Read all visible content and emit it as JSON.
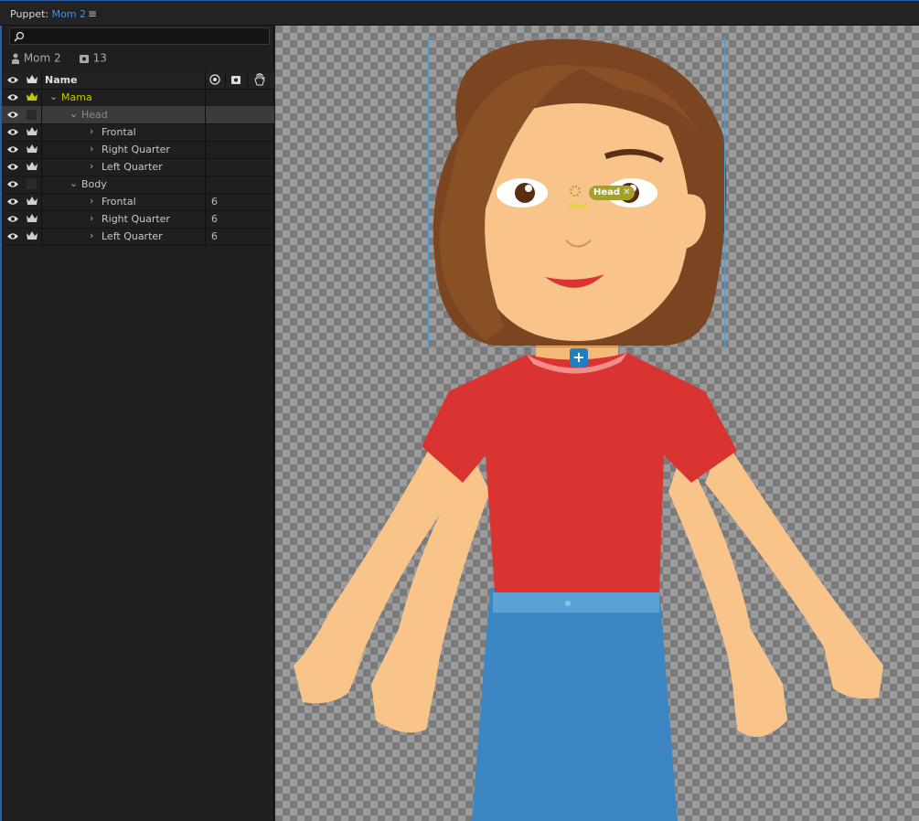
{
  "panel": {
    "title_prefix": "Puppet:",
    "title_name": "Mom 2",
    "menu_icon": "hamburger-icon"
  },
  "search": {
    "placeholder": ""
  },
  "puppet_info": {
    "name": "Mom 2",
    "count": "13"
  },
  "columns": {
    "name": "Name"
  },
  "rows": [
    {
      "label": "Mama",
      "indent": 0,
      "expanded": true,
      "color": "#c8c800",
      "count": ""
    },
    {
      "label": "Head",
      "indent": 1,
      "expanded": true,
      "color": "#8a8a8a",
      "count": "",
      "selected": true
    },
    {
      "label": "Frontal",
      "indent": 2,
      "expanded": false,
      "color": "#c8c8c8",
      "count": ""
    },
    {
      "label": "Right Quarter",
      "indent": 2,
      "expanded": false,
      "color": "#c8c8c8",
      "count": ""
    },
    {
      "label": "Left Quarter",
      "indent": 2,
      "expanded": false,
      "color": "#c8c8c8",
      "count": ""
    },
    {
      "label": "Body",
      "indent": 1,
      "expanded": true,
      "color": "#c8c8c8",
      "count": ""
    },
    {
      "label": "Frontal",
      "indent": 2,
      "expanded": false,
      "color": "#c8c8c8",
      "count": "6"
    },
    {
      "label": "Right Quarter",
      "indent": 2,
      "expanded": false,
      "color": "#c8c8c8",
      "count": "6"
    },
    {
      "label": "Left Quarter",
      "indent": 2,
      "expanded": false,
      "color": "#c8c8c8",
      "count": "6"
    }
  ],
  "canvas": {
    "handle_label": "Head",
    "handle_sub": "Head",
    "add_symbol": "+"
  }
}
